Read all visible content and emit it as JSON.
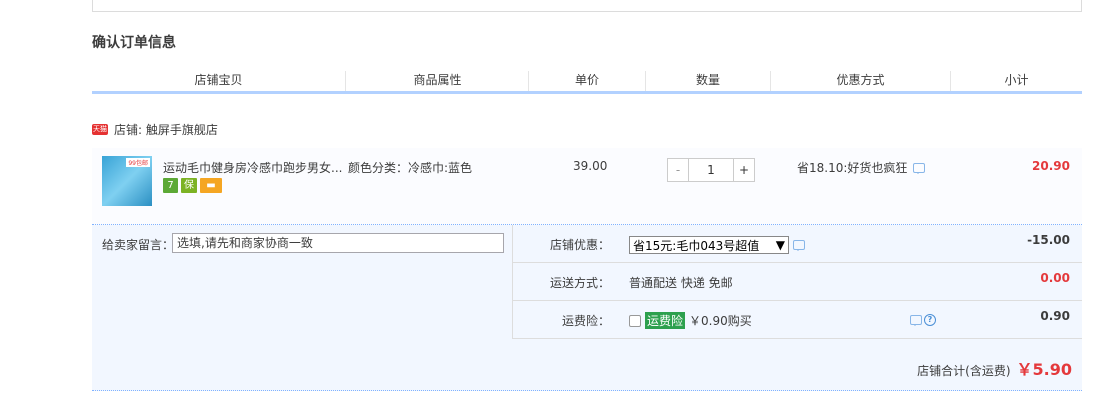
{
  "section": {
    "title": "确认订单信息"
  },
  "headers": [
    "店铺宝贝",
    "商品属性",
    "单价",
    "数量",
    "优惠方式",
    "小计"
  ],
  "shop": {
    "badge": "天猫",
    "label": "店铺: 触屏手旗舰店"
  },
  "item": {
    "thumb_badge": "99包邮",
    "title": "运动毛巾健身房冷感巾跑步男女...",
    "attr": "颜色分类：冷感巾:蓝色",
    "price": "39.00",
    "quantity": "1",
    "minus": "-",
    "plus": "+",
    "promo": "省18.10:好货也疯狂",
    "subtotal": "20.90",
    "service_icons": [
      {
        "name": "seven-day-return-icon",
        "text": "7",
        "color": "#5ca936"
      },
      {
        "name": "guarantee-icon",
        "text": "保",
        "color": "#7cb324"
      },
      {
        "name": "card-payment-icon",
        "text": "▬",
        "color": "#f5a623"
      }
    ]
  },
  "message": {
    "label": "给卖家留言：",
    "placeholder": "选填,请先和商家协商一致"
  },
  "shop_discount": {
    "label": "店铺优惠：",
    "selected": "省15元:毛巾043号超值",
    "amount": "-15.00"
  },
  "shipping": {
    "label": "运送方式：",
    "value": "普通配送 快递 免邮",
    "amount": "0.00"
  },
  "insurance": {
    "label": "运费险：",
    "badge": "运费险",
    "price_text": "￥0.90购买",
    "amount": "0.90",
    "help": "?"
  },
  "total": {
    "label": "店铺合计(含运费)",
    "value": "￥5.90"
  }
}
